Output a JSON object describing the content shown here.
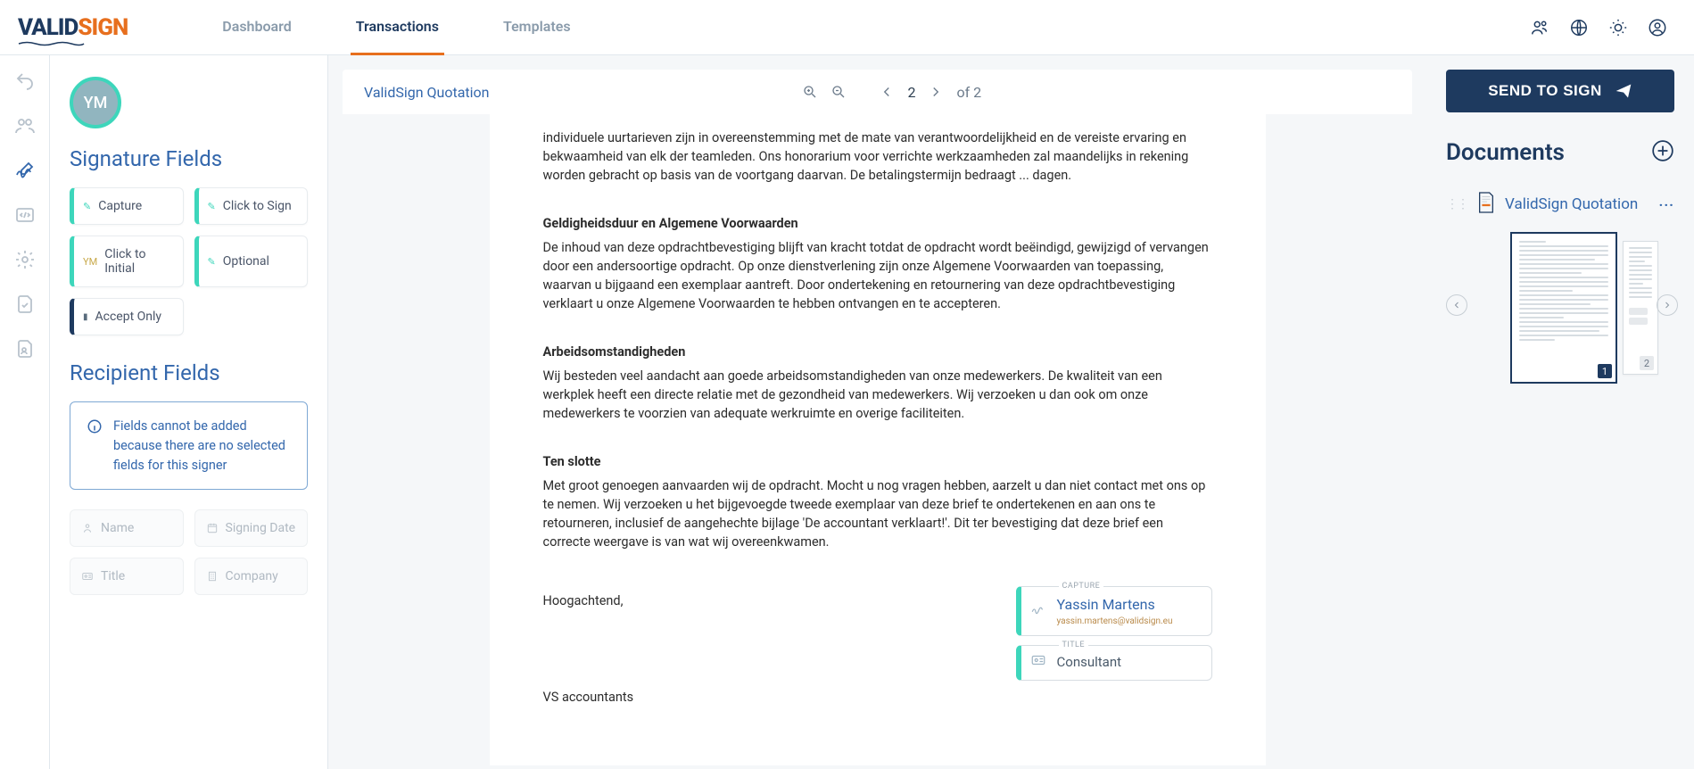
{
  "nav": {
    "dashboard": "Dashboard",
    "transactions": "Transactions",
    "templates": "Templates"
  },
  "avatar_initials": "YM",
  "signature_fields": {
    "heading": "Signature Fields",
    "capture": "Capture",
    "click_to_sign": "Click to Sign",
    "click_to_initial": "Click to Initial",
    "click_to_initial_prefix": "YM",
    "optional": "Optional",
    "accept_only": "Accept Only"
  },
  "recipient_fields": {
    "heading": "Recipient Fields",
    "info": "Fields cannot be added because there are no selected fields for this signer",
    "name": "Name",
    "signing_date": "Signing Date",
    "title": "Title",
    "company": "Company"
  },
  "doc": {
    "title": "ValidSign Quotation",
    "page_current": "2",
    "page_total": "of 2",
    "para_fees": "individuele uurtarieven zijn in overeenstemming met de mate van verantwoordelijkheid en de vereiste ervaring en bekwaamheid van elk der teamleden. Ons honorarium voor verrichte werkzaamheden zal maandelijks in rekening worden gebracht op basis van de voortgang daarvan. De betalingstermijn bedraagt ... dagen.",
    "h_validity": "Geldigheidsduur en Algemene Voorwaarden",
    "para_validity": "De inhoud van deze opdrachtbevestiging blijft van kracht totdat de opdracht wordt beëindigd, gewijzigd of vervangen door een andersoortige opdracht. Op onze dienstverlening zijn onze Algemene Voorwaarden van toepassing, waarvan u bijgaand een exemplaar aantreft. Door ondertekening en retournering van deze opdrachtbevestiging verklaart u onze Algemene Voorwaarden te hebben ontvangen en te accepteren.",
    "h_work": "Arbeidsomstandigheden",
    "para_work": "Wij besteden veel aandacht aan goede arbeidsomstandigheden van onze medewerkers. De kwaliteit van een werkplek heeft een directe relatie met de gezondheid van medewerkers. Wij verzoeken u dan ook om onze medewerkers te voorzien van adequate werkruimte en overige faciliteiten.",
    "h_finally": "Ten slotte",
    "para_finally": "Met groot genoegen aanvaarden wij de opdracht. Mocht u nog vragen hebben, aarzelt u dan niet contact met ons op te nemen. Wij verzoeken u het bijgevoegde tweede exemplaar van deze brief te ondertekenen en aan ons te retourneren, inclusief de aangehechte bijlage 'De accountant verklaart!'. Dit ter bevestiging dat deze brief een correcte weergave is van wat wij overeenkwamen.",
    "closing": "Hoogachtend,",
    "company_line": "VS accountants",
    "capture_label": "CAPTURE",
    "capture_name": "Yassin Martens",
    "capture_email": "yassin.martens@validsign.eu",
    "title_label": "TITLE",
    "title_value": "Consultant"
  },
  "right": {
    "send": "SEND TO SIGN",
    "documents": "Documents",
    "doc_name": "ValidSign Quotation",
    "pg1": "1",
    "pg2": "2"
  }
}
